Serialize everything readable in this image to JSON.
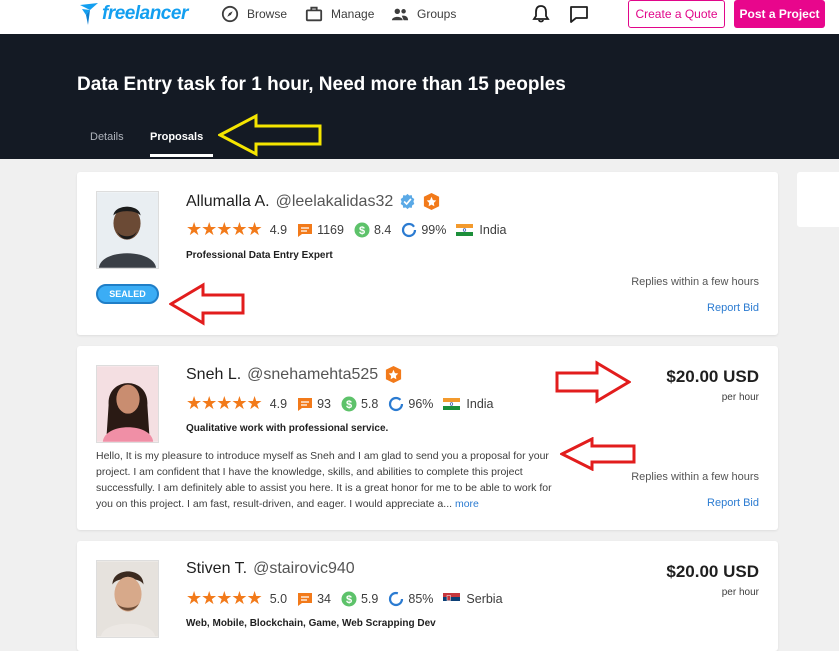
{
  "nav": {
    "logo_text": "freelancer",
    "browse": "Browse",
    "manage": "Manage",
    "groups": "Groups",
    "create_quote": "Create a Quote",
    "post_project": "Post a Project"
  },
  "hero": {
    "title": "Data Entry task for 1 hour, Need more than 15 peoples",
    "tabs": [
      "Details",
      "Proposals"
    ],
    "active_tab": "Proposals"
  },
  "colors": {
    "brand_blue": "#139ff0",
    "brand_pink": "#e8068c",
    "hero_bg": "#141a24",
    "star_orange": "#f27a1a",
    "link_blue": "#2b7bd1"
  },
  "bids": [
    {
      "name": "Allumalla A.",
      "username": "@leelakalidas32",
      "rating": "4.9",
      "reviews": "1169",
      "earnings_score": "8.4",
      "completion": "99%",
      "country": "India",
      "tagline": "Professional Data Entry Expert",
      "sealed_label": "SEALED",
      "replies": "Replies within a few hours",
      "report": "Report Bid"
    },
    {
      "name": "Sneh L.",
      "username": "@snehamehta525",
      "rating": "4.9",
      "reviews": "93",
      "earnings_score": "5.8",
      "completion": "96%",
      "country": "India",
      "tagline": "Qualitative work with professional service.",
      "price": "$20.00 USD",
      "per": "per hour",
      "description": "Hello, It is my pleasure to introduce myself as Sneh and I am glad to send you a proposal for your project. I am confident that I have the knowledge, skills, and abilities to complete this project successfully. I am definitely able to assist you here. It is a great honor for me to be able to work for you on this project. I am fast, result-driven, and eager. I would appreciate a...",
      "more": "more",
      "replies": "Replies within a few hours",
      "report": "Report Bid"
    },
    {
      "name": "Stiven T.",
      "username": "@stairovic940",
      "rating": "5.0",
      "reviews": "34",
      "earnings_score": "5.9",
      "completion": "85%",
      "country": "Serbia",
      "tagline": "Web, Mobile, Blockchain, Game, Web Scrapping Dev",
      "price": "$20.00 USD",
      "per": "per hour"
    }
  ]
}
